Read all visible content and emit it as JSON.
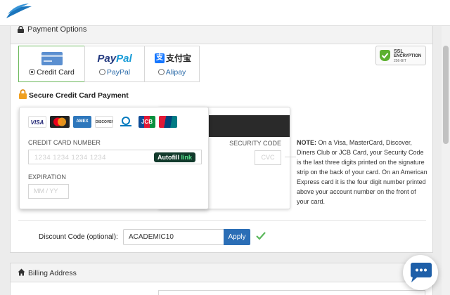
{
  "header": {
    "logo_icon": "feather-logo-icon",
    "brand_color": "#1b75bc"
  },
  "payment_options": {
    "title": "Payment Options",
    "tabs": [
      {
        "label": "Credit Card",
        "selected": true,
        "icon": "credit-card-icon"
      },
      {
        "label": "PayPal",
        "selected": false,
        "logo_text_1": "Pay",
        "logo_text_2": "Pal"
      },
      {
        "label": "Alipay",
        "selected": false,
        "logo_mark": "支",
        "logo_text": "支付宝"
      }
    ],
    "ssl_badge": {
      "line1": "SSL",
      "line2": "ENCRYPTION",
      "line3": "256-BIT"
    }
  },
  "credit_card": {
    "section_title": "Secure Credit Card Payment",
    "brands": [
      "VISA",
      "MasterCard",
      "AMEX",
      "DISCOVER",
      "Diners Club",
      "JCB",
      "UnionPay"
    ],
    "card_number_label": "CREDIT CARD NUMBER",
    "card_number_placeholder": "1234  1234  1234  1234",
    "autofill_text": "Autofill",
    "autofill_link": "link",
    "expiration_label": "EXPIRATION",
    "expiration_placeholder": "MM  /  YY",
    "security_code_label": "SECURITY CODE",
    "cvc_placeholder": "CVC",
    "note_bold": "NOTE:",
    "note_text": " On a Visa, MasterCard, Discover, Diners Club or JCB Card, your Security Code is the last three digits printed on the signature strip on the back of your card. On an American Express card it is the four digit number printed above your account number on the front of your card."
  },
  "discount": {
    "label": "Discount Code (optional):",
    "value": "ACADEMIC10",
    "apply_label": "Apply",
    "applied": true
  },
  "billing": {
    "title": "Billing Address"
  },
  "colors": {
    "accent": "#2b6eb6",
    "success": "#5cb85c",
    "active_tab_border": "#6cb85c"
  }
}
